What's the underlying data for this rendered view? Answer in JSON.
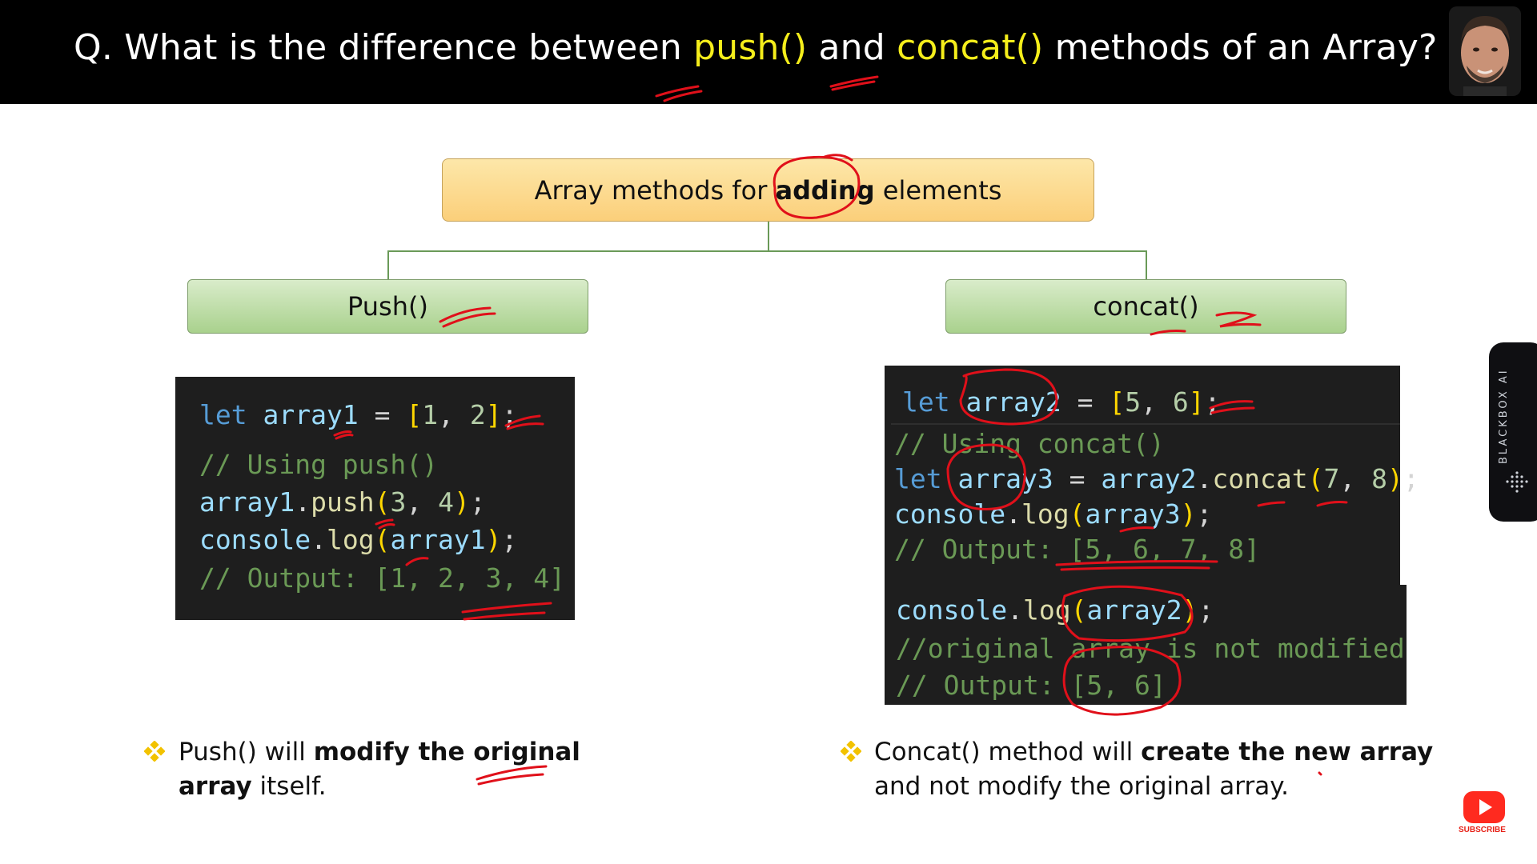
{
  "header": {
    "prefix": "Q. What is the difference between ",
    "method1": "push()",
    "middle": " and ",
    "method2": "concat()",
    "suffix": " methods of an Array?"
  },
  "tree": {
    "root": {
      "before": "Array methods for ",
      "bold": "adding",
      "after": " elements"
    },
    "left": "Push()",
    "right": "concat()"
  },
  "push_code": {
    "l1": {
      "kw": "let",
      "var": "array1",
      "eq": " = ",
      "ob": "[",
      "n1": "1",
      "sep": ", ",
      "n2": "2",
      "cb": "]",
      "end": ";"
    },
    "l2": "// Using push()",
    "l3": {
      "obj": "array1",
      "dot": ".",
      "fn": "push",
      "op": "(",
      "n1": "3",
      "sep": ", ",
      "n2": "4",
      "cp": ")",
      "end": ";"
    },
    "l4": {
      "obj": "console",
      "dot": ".",
      "fn": "log",
      "op": "(",
      "arg": "array1",
      "cp": ")",
      "end": ";"
    },
    "l5": "// Output: [1, 2, 3, 4]"
  },
  "concat_code": {
    "l1": {
      "kw": "let",
      "var": "array2",
      "eq": " = ",
      "ob": "[",
      "n1": "5",
      "sep": ", ",
      "n2": "6",
      "cb": "]",
      "end": ";"
    },
    "l2": "// Using concat()",
    "l3": {
      "kw": "let",
      "var": "array3",
      "eq": " = ",
      "obj": "array2",
      "dot": ".",
      "fn": "concat",
      "op": "(",
      "n1": "7",
      "sep": ", ",
      "n2": "8",
      "cp": ")",
      "end": ";"
    },
    "l4": {
      "obj": "console",
      "dot": ".",
      "fn": "log",
      "op": "(",
      "arg": "array3",
      "cp": ")",
      "end": ";"
    },
    "l5": "// Output: [5, 6, 7, 8]",
    "l6": {
      "obj": "console",
      "dot": ".",
      "fn": "log",
      "op": "(",
      "arg": "array2",
      "cp": ")",
      "end": ";"
    },
    "l7": "//original array is not modified",
    "l8": "// Output: [5, 6]"
  },
  "notes": {
    "left": {
      "a": "Push() will ",
      "b": "modify the original",
      "c": "array",
      "d": " itself."
    },
    "right": {
      "a": "Concat() method will ",
      "b": "create the new array",
      "c": "and not modify the original array."
    }
  },
  "widgets": {
    "side_label": "BLACKBOX AI",
    "subscribe": "SUBSCRIBE"
  },
  "colors": {
    "header_bg": "#000000",
    "highlight": "#f5ee1b",
    "root_box": "#fbcf7a",
    "child_box": "#a9d18d",
    "code_bg": "#1e1e1e",
    "annotation_ink": "#e0101a"
  }
}
